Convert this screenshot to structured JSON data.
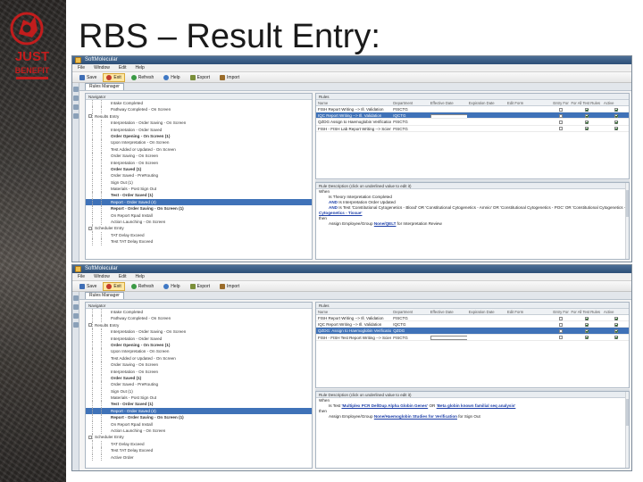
{
  "slide": {
    "title": "RBS – Result Entry:",
    "logo_text_1": "JUST",
    "logo_text_2": "BENEFIT"
  },
  "colors": {
    "accent": "#3f72b8",
    "title_bar": "#2d4f77",
    "logo_red": "#c21d1d"
  },
  "apps": [
    {
      "window_title": "SoftMolecular",
      "menu": [
        "File",
        "Window",
        "Edit",
        "Help"
      ],
      "toolbar": [
        {
          "label": "Save",
          "icon": "save-icon"
        },
        {
          "label": "Exit",
          "icon": "exit-icon",
          "active": true
        },
        {
          "label": "Refresh",
          "icon": "refresh-icon"
        },
        {
          "label": "Help",
          "icon": "help-icon"
        },
        {
          "label": "Export",
          "icon": "export-icon"
        },
        {
          "label": "Import",
          "icon": "import-icon"
        }
      ],
      "tab": "Rules Manager",
      "nav_header": "Navigator",
      "tree": [
        {
          "label": "Intake Completed",
          "level": 2
        },
        {
          "label": "Pathway Completed - On Screen",
          "level": 2
        },
        {
          "label": "Results Entry",
          "level": 1,
          "expand": "-"
        },
        {
          "label": "Interpretation - Order Saving - On Screen",
          "level": 2
        },
        {
          "label": "Interpretation - Order Saved",
          "level": 2
        },
        {
          "label": "Order Opening - On Screen (1)",
          "level": 2,
          "bold": true
        },
        {
          "label": "Upon Interpretation - On Screen",
          "level": 2
        },
        {
          "label": "Test Added or Updated - On Screen",
          "level": 2
        },
        {
          "label": "Order Saving - On Screen",
          "level": 2
        },
        {
          "label": "Interpretation - On Screen",
          "level": 2
        },
        {
          "label": "Order Saved (1)",
          "level": 2,
          "bold": true
        },
        {
          "label": "Order Saved - PreRouting",
          "level": 2
        },
        {
          "label": "Sign Out (1)",
          "level": 2
        },
        {
          "label": "Materials - Post Sign Out",
          "level": 2
        },
        {
          "label": "Test - Order Saved (1)",
          "level": 2,
          "bold": true
        },
        {
          "label": "Report - Order Saved (4)",
          "level": 2,
          "selected": true
        },
        {
          "label": "Report - Order Saving - On Screen (1)",
          "level": 2,
          "bold": true
        },
        {
          "label": "On Report Rpad Install",
          "level": 2
        },
        {
          "label": "Action Launching - On Screen",
          "level": 2
        },
        {
          "label": "Scheduler Entry",
          "level": 1,
          "expand": "-"
        },
        {
          "label": "TAT Delay Exceed",
          "level": 2
        },
        {
          "label": "Test TAT Delay Exceed",
          "level": 2
        }
      ],
      "rules_header": "Rules",
      "columns": [
        "Name",
        "Department",
        "Effective Date",
        "Expiration Date",
        "Edit Form",
        "Entry Form",
        "For All Test Rules",
        "Active"
      ],
      "rows": [
        {
          "name": "FISH Report Writing --> Ill. Validation",
          "dept": "FISCTG",
          "dropdown": false,
          "c5": false,
          "c6": true,
          "c7": true,
          "selected": false
        },
        {
          "name": "IQC Report Writing --> Ill. Validation",
          "dept": "IQCTG",
          "dropdown": true,
          "c5": false,
          "c6": true,
          "c7": true,
          "selected": true
        },
        {
          "name": "QZDG Assign to Haemoglobin Verification",
          "dept": "FISCTG",
          "dropdown": false,
          "c5": false,
          "c6": true,
          "c7": true,
          "selected": false
        },
        {
          "name": "FISH - FISH Lab Report Writing --> Scientist R...",
          "dept": "FISCTG",
          "dropdown": false,
          "c5": false,
          "c6": true,
          "c7": true,
          "selected": false
        }
      ],
      "desc_header": "Rule Description (click on underlined value to edit it)",
      "desc_when": "When",
      "desc_lines": [
        {
          "pre": "Is Theory Interpretation Completed",
          "lnk": "",
          "post": "",
          "indent": true
        },
        {
          "pre": "AND",
          "lnk": "",
          "post": " Is Interpretation Order Updated",
          "indent": true,
          "kw": true
        },
        {
          "pre": "AND",
          "lnk": "",
          "post": " Is Test 'Constitutional Cytogenetics - Blood' OR 'Constitutional Cytogenetics - Amnio' OR 'Constitutional Cytogenetics - POC' OR 'Constitutional Cytogenetics - CVP' OR",
          "indent": true,
          "kw": true
        },
        {
          "pre": "",
          "lnk": "Cytogenetics - Tissue'",
          "post": "",
          "indent": false
        },
        {
          "pre": "then",
          "lnk": "",
          "post": "",
          "indent": false
        },
        {
          "pre": "Assign Employee/Group ",
          "lnk": "None/QELT",
          "post": " for Interpretation Review",
          "indent": true
        }
      ]
    },
    {
      "window_title": "SoftMolecular",
      "menu": [
        "File",
        "Window",
        "Edit",
        "Help"
      ],
      "toolbar": [
        {
          "label": "Save",
          "icon": "save-icon"
        },
        {
          "label": "Exit",
          "icon": "exit-icon",
          "active": true
        },
        {
          "label": "Refresh",
          "icon": "refresh-icon"
        },
        {
          "label": "Help",
          "icon": "help-icon"
        },
        {
          "label": "Export",
          "icon": "export-icon"
        },
        {
          "label": "Import",
          "icon": "import-icon"
        }
      ],
      "tab": "Rules Manager",
      "nav_header": "Navigator",
      "tree": [
        {
          "label": "Intake Completed",
          "level": 2
        },
        {
          "label": "Pathway Completed - On Screen",
          "level": 2
        },
        {
          "label": "Results Entry",
          "level": 1,
          "expand": "-"
        },
        {
          "label": "Interpretation - Order Saving - On Screen",
          "level": 2
        },
        {
          "label": "Interpretation - Order Saved",
          "level": 2
        },
        {
          "label": "Order Opening - On Screen (1)",
          "level": 2,
          "bold": true
        },
        {
          "label": "Upon Interpretation - On Screen",
          "level": 2
        },
        {
          "label": "Test Added or Updated - On Screen",
          "level": 2
        },
        {
          "label": "Order Saving - On Screen",
          "level": 2
        },
        {
          "label": "Interpretation - On Screen",
          "level": 2
        },
        {
          "label": "Order Saved (1)",
          "level": 2,
          "bold": true
        },
        {
          "label": "Order Saved - PreRouting",
          "level": 2
        },
        {
          "label": "Sign Out (1)",
          "level": 2
        },
        {
          "label": "Materials - Post Sign Out",
          "level": 2
        },
        {
          "label": "Test - Order Saved (1)",
          "level": 2,
          "bold": true
        },
        {
          "label": "Report - Order Saved (4)",
          "level": 2,
          "selected": true
        },
        {
          "label": "Report - Order Saving - On Screen (1)",
          "level": 2,
          "bold": true
        },
        {
          "label": "On Report Rpad Install",
          "level": 2
        },
        {
          "label": "Action Launching - On Screen",
          "level": 2
        },
        {
          "label": "Scheduler Entry",
          "level": 1,
          "expand": "-"
        },
        {
          "label": "TAT Delay Exceed",
          "level": 2
        },
        {
          "label": "Test TAT Delay Exceed",
          "level": 2
        },
        {
          "label": "Active Order",
          "level": 2
        }
      ],
      "rules_header": "Rules",
      "columns": [
        "Name",
        "Department",
        "Effective Date",
        "Expiration Date",
        "Edit Form",
        "Entry Form",
        "For All Test Rules",
        "Active"
      ],
      "rows": [
        {
          "name": "FISH Report Writing --> Ill. Validation",
          "dept": "FISCTG",
          "dropdown": false,
          "c5": false,
          "c6": true,
          "c7": true,
          "selected": false
        },
        {
          "name": "IQC Report Writing --> Ill. Validation",
          "dept": "IQCTG",
          "dropdown": false,
          "c5": false,
          "c6": true,
          "c7": true,
          "selected": false
        },
        {
          "name": "QZDG: Assign to Haemoglobin Verification",
          "dept": "QZDG",
          "dropdown": false,
          "c5": false,
          "c6": true,
          "c7": true,
          "selected": true
        },
        {
          "name": "FISH - FISH Test Report Writing --> Scientist R...",
          "dept": "FISCTG",
          "dropdown": true,
          "c5": false,
          "c6": true,
          "c7": true,
          "selected": false
        }
      ],
      "desc_header": "Rule Description (click on underlined value to edit it)",
      "desc_when": "When",
      "desc_lines": [
        {
          "pre": "Is Test ",
          "lnk": "'Multiplex PCR Del/Dup Alpha Globin Genes'",
          "post": " OR ",
          "lnk2": "'Beta globin known familial seq analysis'",
          "indent": true
        },
        {
          "pre": "then",
          "lnk": "",
          "post": "",
          "indent": false
        },
        {
          "pre": "Assign Employee/Group ",
          "lnk": "None/Haemoglobin Studies for Verification",
          "post": " for Sign Out",
          "indent": true
        }
      ]
    }
  ]
}
